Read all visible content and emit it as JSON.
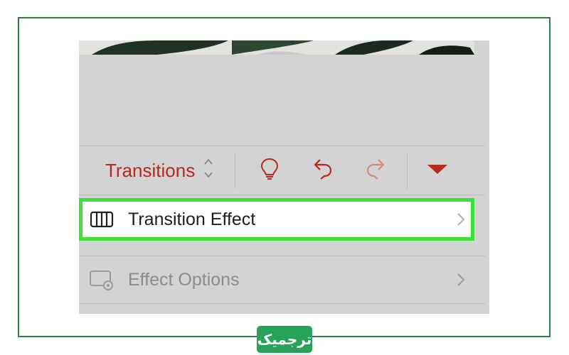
{
  "toolbar": {
    "tab_label": "Transitions",
    "icons": [
      "chevron-up-down-icon",
      "lightbulb-icon",
      "undo-icon",
      "redo-icon",
      "collapse-triangle-icon"
    ]
  },
  "menu": {
    "items": [
      {
        "label": "Transition Effect",
        "icon": "transition-effect-icon",
        "highlighted": true
      },
      {
        "label": "Effect Options",
        "icon": "effect-options-icon",
        "enabled": false
      }
    ]
  },
  "watermark": {
    "text": "ترجمیک"
  },
  "colors": {
    "accent": "#b52a1e",
    "highlight": "#3ee03c",
    "badge": "#2aa35a",
    "frame": "#2e7d4a"
  }
}
